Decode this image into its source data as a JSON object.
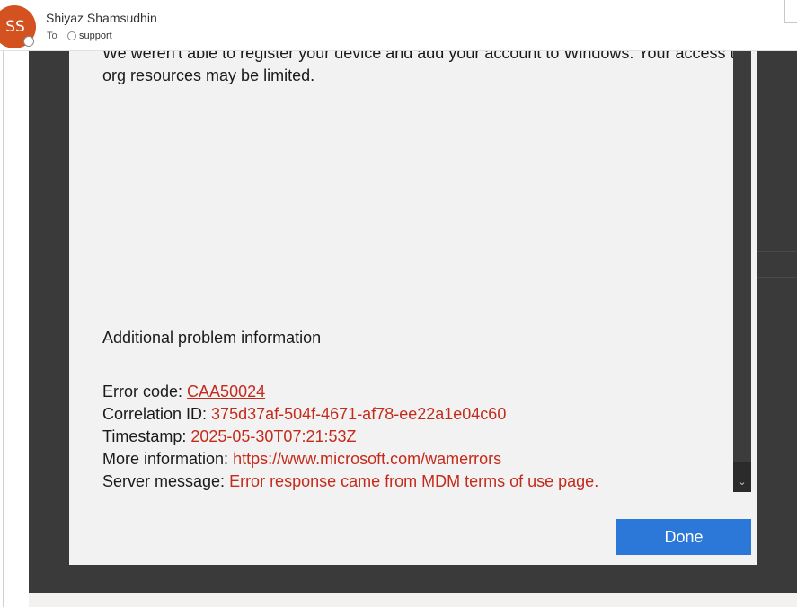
{
  "email": {
    "avatar_initials": "SS",
    "sender_name": "Shiyaz Shamsudhin",
    "to_label": "To",
    "recipient": "support"
  },
  "dialog": {
    "message": "We weren't able to register your device and add your account to Windows. Your access to org resources may be limited.",
    "section_title": "Additional problem information",
    "info": [
      {
        "label": "Error code: ",
        "value": "CAA50024"
      },
      {
        "label": "Correlation ID: ",
        "value": "375d37af-504f-4671-af78-ee22a1e04c60"
      },
      {
        "label": "Timestamp: ",
        "value": "2025-05-30T07:21:53Z"
      },
      {
        "label": "More information: ",
        "value": "https://www.microsoft.com/wamerrors"
      },
      {
        "label": "Server message: ",
        "value": "Error response came from MDM terms of use page."
      }
    ],
    "done_label": "Done"
  },
  "icons": {
    "scroll_down": "chevron-down-icon",
    "presence": "presence-status-icon"
  },
  "colors": {
    "avatar_bg": "#d35220",
    "error_text": "#c42b1c",
    "button_bg": "#2b78d8",
    "overlay": "#3a3a3a",
    "dialog_bg": "#f2f2f2"
  }
}
